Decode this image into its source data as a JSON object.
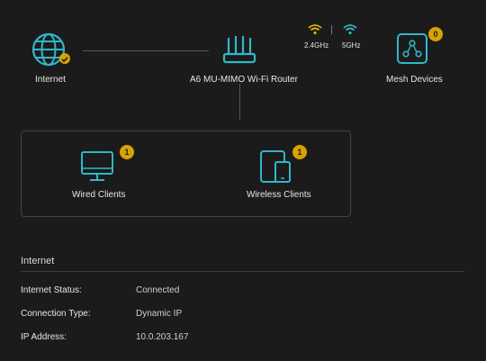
{
  "topology": {
    "internet": {
      "label": "Internet"
    },
    "router": {
      "label": "A6 MU-MIMO Wi-Fi Router"
    },
    "bands": {
      "band1": "2.4GHz",
      "band2": "5GHz"
    },
    "mesh": {
      "label": "Mesh Devices",
      "count": "0"
    },
    "wired": {
      "label": "Wired Clients",
      "count": "1"
    },
    "wireless": {
      "label": "Wireless Clients",
      "count": "1"
    }
  },
  "internet_section": {
    "title": "Internet",
    "rows": [
      {
        "key": "Internet Status:",
        "value": "Connected"
      },
      {
        "key": "Connection Type:",
        "value": "Dynamic IP"
      },
      {
        "key": "IP Address:",
        "value": "10.0.203.167"
      }
    ]
  },
  "colors": {
    "accent": "#2fb8c9",
    "badge": "#d6a300",
    "wifi_24": "#e0b000",
    "wifi_5": "#2fb8c9"
  }
}
